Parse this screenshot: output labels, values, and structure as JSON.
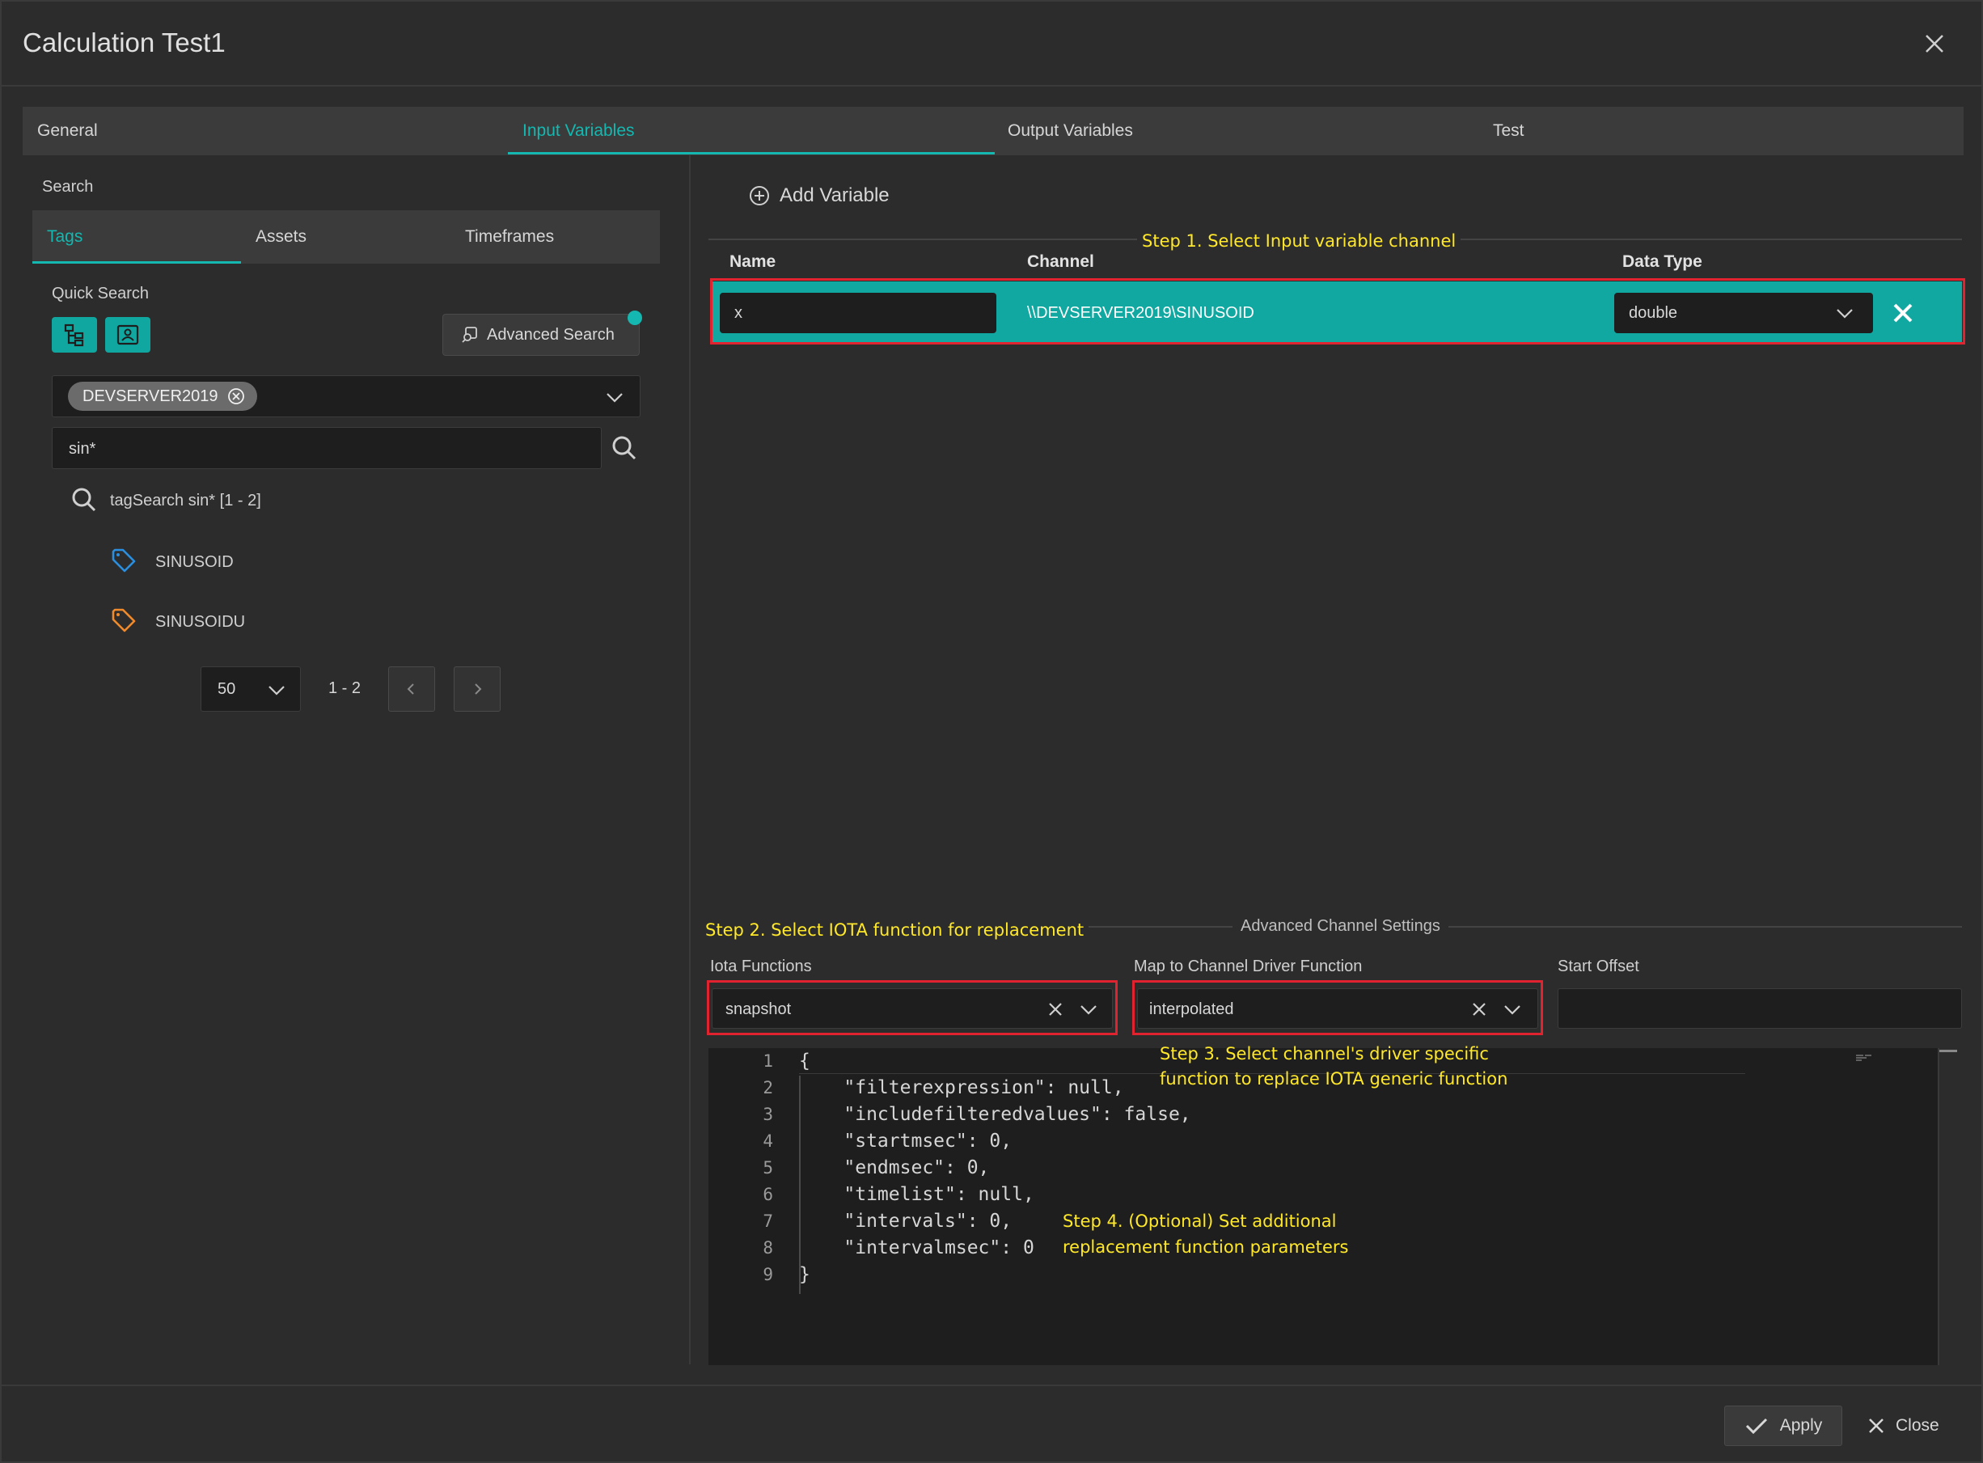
{
  "dialog": {
    "title": "Calculation Test1"
  },
  "tabs": [
    "General",
    "Input Variables",
    "Output Variables",
    "Test"
  ],
  "left": {
    "search_label": "Search",
    "subtabs": [
      "Tags",
      "Assets",
      "Timeframes"
    ],
    "quick_search_label": "Quick Search",
    "advanced_search_label": "Advanced Search",
    "server_chip": "DEVSERVER2019",
    "search_value": "sin*",
    "tree_root": "tagSearch sin* [1 - 2]",
    "results": [
      {
        "name": "SINUSOID",
        "color": "#2a8fe0"
      },
      {
        "name": "SINUSOIDU",
        "color": "#f08a2a"
      }
    ],
    "page_size": "50",
    "page_range": "1 - 2"
  },
  "right": {
    "add_variable_label": "Add Variable",
    "columns": {
      "name": "Name",
      "channel": "Channel",
      "data_type": "Data Type"
    },
    "row": {
      "name": "x",
      "channel": "\\\\DEVSERVER2019\\SINUSOID",
      "data_type": "double"
    },
    "annotations": {
      "step1": "Step 1. Select Input variable channel",
      "step2": "Step 2. Select IOTA function for replacement",
      "step3_line1": "Step 3. Select channel's driver specific",
      "step3_line2": "function to replace IOTA generic function",
      "step4_line1": "Step 4. (Optional) Set additional",
      "step4_line2": "replacement function parameters"
    },
    "advanced_title": "Advanced Channel Settings",
    "iota_label": "Iota Functions",
    "iota_value": "snapshot",
    "map_label": "Map to Channel Driver Function",
    "map_value": "interpolated",
    "offset_label": "Start Offset",
    "offset_value": "",
    "code": [
      "{",
      "    \"filterexpression\": null,",
      "    \"includefilteredvalues\": false,",
      "    \"startmsec\": 0,",
      "    \"endmsec\": 0,",
      "    \"timelist\": null,",
      "    \"intervals\": 0,",
      "    \"intervalmsec\": 0",
      "}"
    ],
    "line_numbers": [
      "1",
      "2",
      "3",
      "4",
      "5",
      "6",
      "7",
      "8",
      "9"
    ]
  },
  "footer": {
    "apply_label": "Apply",
    "close_label": "Close"
  },
  "colors": {
    "accent": "#14b8b0",
    "annotation": "#ffe82a",
    "highlight_box": "#e0232f"
  }
}
